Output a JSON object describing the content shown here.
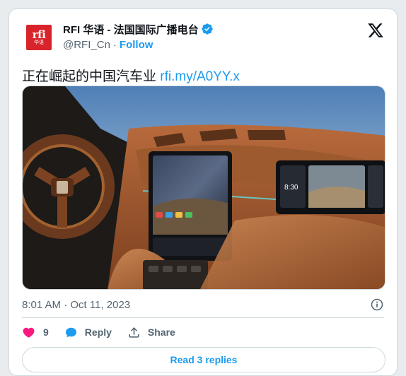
{
  "account": {
    "display_name": "RFI 华语 - 法国国际广播电台",
    "handle": "@RFI_Cn",
    "separator": "·",
    "follow_label": "Follow",
    "avatar_logo": "rfi",
    "avatar_sub": "华语"
  },
  "tweet": {
    "text": "正在崛起的中国汽车业",
    "link": "rfi.my/A0YY.x"
  },
  "meta": {
    "timestamp": "8:01 AM · Oct 11, 2023"
  },
  "actions": {
    "like_count": "9",
    "reply_label": "Reply",
    "share_label": "Share"
  },
  "replies_button": "Read 3 replies",
  "colors": {
    "accent": "#1d9bf0",
    "like": "#f91880",
    "brand_red": "#d8232a",
    "secondary_text": "#536471"
  },
  "media": {
    "screen_clock": "8:30"
  }
}
